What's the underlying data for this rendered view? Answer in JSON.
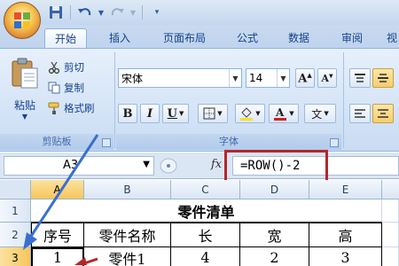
{
  "qat": {
    "undo": "undo-icon",
    "redo": "redo-icon",
    "save": "save-icon"
  },
  "tabs": [
    {
      "label": "开始",
      "active": true
    },
    {
      "label": "插入"
    },
    {
      "label": "页面布局"
    },
    {
      "label": "公式"
    },
    {
      "label": "数据"
    },
    {
      "label": "审阅"
    },
    {
      "label": "视"
    }
  ],
  "clipboard": {
    "paste_label": "粘贴",
    "cut_label": "剪切",
    "copy_label": "复制",
    "format_painter_label": "格式刷",
    "group_label": "剪贴板"
  },
  "font": {
    "name": "宋体",
    "size": "14",
    "bold": "B",
    "italic": "I",
    "underline": "U",
    "group_label": "字体",
    "phonetic": "文"
  },
  "formula_bar": {
    "name_box": "A3",
    "fx": "fx",
    "formula": "=ROW()-2"
  },
  "grid": {
    "columns": [
      "A",
      "B",
      "C",
      "D",
      "E"
    ],
    "rows": [
      "1",
      "2",
      "3"
    ],
    "title": "零件清单",
    "headers": [
      "序号",
      "零件名称",
      "长",
      "宽",
      "高"
    ],
    "row3": [
      "1",
      "零件1",
      "4",
      "2",
      "3"
    ],
    "selected_cell": "A3"
  },
  "colors": {
    "annotation_red": "#b7252a",
    "annotation_blue": "#3a6fd0"
  }
}
